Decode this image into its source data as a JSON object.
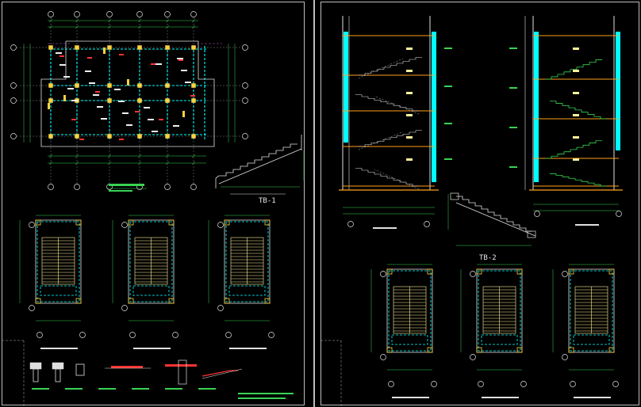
{
  "sheets": {
    "left": {
      "labels": {
        "tb1": "TB-1"
      }
    },
    "right": {
      "labels": {
        "tb2": "TB-2"
      }
    }
  },
  "colors": {
    "background": "#000000",
    "axis_grid": "#e0e0e0",
    "dimension": "#39d353",
    "beam_dashed": "#00ffff",
    "column": "#ffd23f",
    "stair_tread": "#fff29a",
    "rebar_red": "#ff3333",
    "wall_orange": "#ff9f1c",
    "outline_magenta": "#c050c0"
  }
}
